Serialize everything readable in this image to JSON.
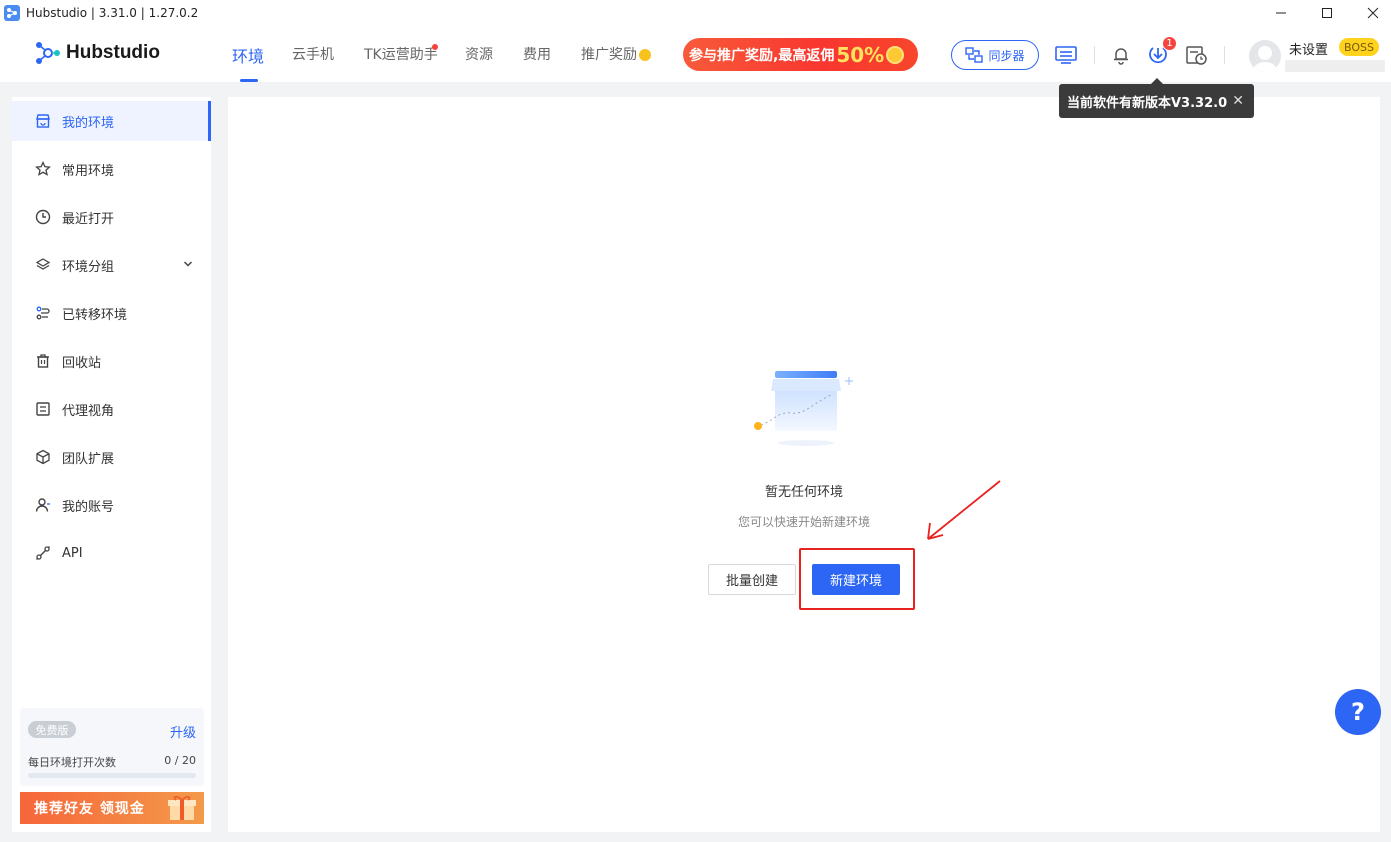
{
  "window": {
    "title": "Hubstudio | 3.31.0 | 1.27.0.2",
    "minimize": "—",
    "maximize": "☐",
    "close": "✕"
  },
  "header": {
    "logo_text": "Hubstudio",
    "nav": [
      {
        "label": "环境",
        "active": true
      },
      {
        "label": "云手机"
      },
      {
        "label": "TK运营助手",
        "dot": true
      },
      {
        "label": "资源"
      },
      {
        "label": "费用"
      },
      {
        "label": "推广奖励"
      }
    ],
    "promo": {
      "text": "参与推广奖励,最高返佣",
      "percent": "50%"
    },
    "sync_label": "同步器",
    "update_badge": "1",
    "user_name": "未设置",
    "boss_label": "BOSS"
  },
  "tooltip": {
    "text": "当前软件有新版本V3.32.0",
    "close": "✕"
  },
  "sidebar": {
    "items": [
      {
        "label": "我的环境",
        "icon": "store-icon",
        "active": true
      },
      {
        "label": "常用环境",
        "icon": "star-icon"
      },
      {
        "label": "最近打开",
        "icon": "clock-icon"
      },
      {
        "label": "环境分组",
        "icon": "layers-icon"
      },
      {
        "label": "已转移环境",
        "icon": "transfer-icon"
      },
      {
        "label": "回收站",
        "icon": "trash-icon"
      },
      {
        "label": "代理视角",
        "icon": "proxy-icon"
      },
      {
        "label": "团队扩展",
        "icon": "cube-icon"
      },
      {
        "label": "我的账号",
        "icon": "user-icon"
      },
      {
        "label": "API",
        "icon": "api-icon"
      }
    ],
    "plan": {
      "badge": "免费版",
      "upgrade": "升级",
      "usage_label": "每日环境打开次数",
      "usage_count": "0 / 20",
      "usage_fraction": 0
    },
    "referral": "推荐好友 领现金"
  },
  "main": {
    "empty_title": "暂无任何环境",
    "empty_subtitle": "您可以快速开始新建环境",
    "batch_create": "批量创建",
    "new_env": "新建环境"
  },
  "help": "?",
  "colors": {
    "accent": "#2d66f5",
    "highlight": "#e8231f",
    "promo": "#f8362f"
  }
}
